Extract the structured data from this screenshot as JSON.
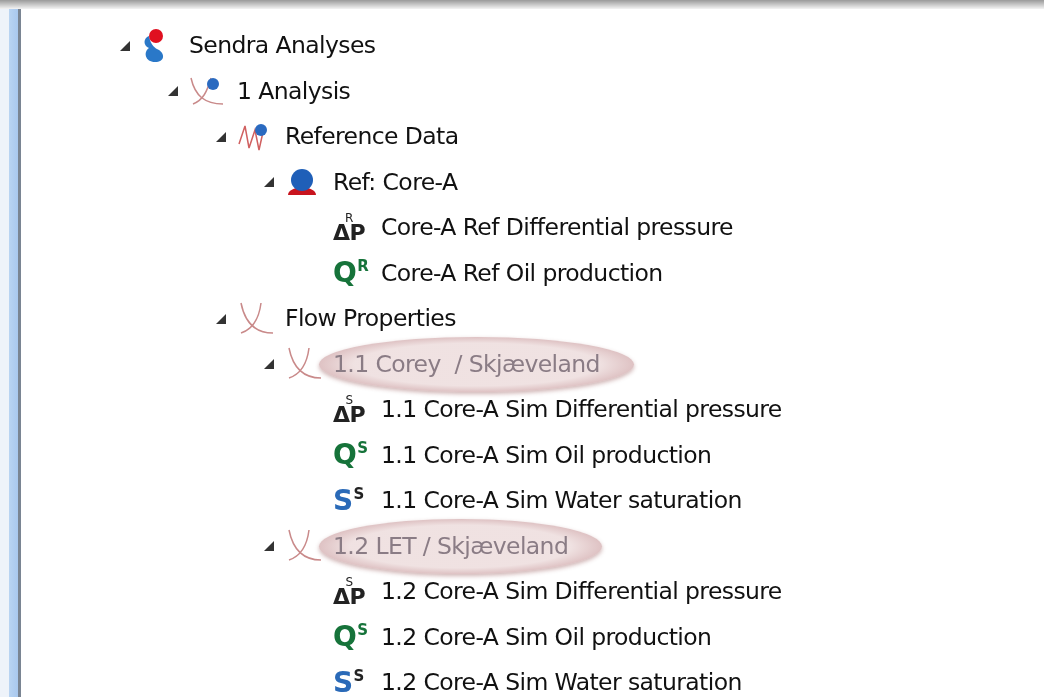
{
  "tree": [
    {
      "label": "Sendra Analyses",
      "kind": "dataset",
      "expanded": true,
      "highlighted": false,
      "children": [
        {
          "label": "1 Analysis",
          "kind": "analysis",
          "expanded": true,
          "highlighted": false,
          "children": [
            {
              "label": "Reference Data",
              "kind": "reference",
              "expanded": true,
              "highlighted": false,
              "children": [
                {
                  "label": "Ref: Core-A",
                  "kind": "core",
                  "expanded": true,
                  "highlighted": false,
                  "children": [
                    {
                      "label": "Core-A Ref Differential pressure",
                      "kind": "pressure",
                      "symbol": "ΔP",
                      "sup": "R",
                      "highlighted": false
                    },
                    {
                      "label": "Core-A Ref Oil production",
                      "kind": "production",
                      "symbol": "Q",
                      "sup": "R",
                      "highlighted": false
                    }
                  ]
                }
              ]
            },
            {
              "label": "Flow Properties",
              "kind": "flow",
              "expanded": true,
              "highlighted": false,
              "children": [
                {
                  "label": "1.1 Corey  / Skjæveland",
                  "kind": "flow",
                  "expanded": true,
                  "highlighted": true,
                  "children": [
                    {
                      "label": "1.1 Core-A Sim Differential pressure",
                      "kind": "pressure",
                      "symbol": "ΔP",
                      "sup": "S",
                      "highlighted": false
                    },
                    {
                      "label": "1.1 Core-A Sim Oil production",
                      "kind": "production",
                      "symbol": "Q",
                      "sup": "S",
                      "highlighted": false
                    },
                    {
                      "label": "1.1 Core-A Sim Water saturation",
                      "kind": "saturation",
                      "symbol": "S",
                      "sup": "S",
                      "highlighted": false
                    }
                  ]
                },
                {
                  "label": "1.2 LET / Skjæveland",
                  "kind": "flow",
                  "expanded": true,
                  "highlighted": true,
                  "children": [
                    {
                      "label": "1.2 Core-A Sim Differential pressure",
                      "kind": "pressure",
                      "symbol": "ΔP",
                      "sup": "S",
                      "highlighted": false
                    },
                    {
                      "label": "1.2 Core-A Sim Oil production",
                      "kind": "production",
                      "symbol": "Q",
                      "sup": "S",
                      "highlighted": false
                    },
                    {
                      "label": "1.2 Core-A Sim Water saturation",
                      "kind": "saturation",
                      "symbol": "S",
                      "sup": "S",
                      "highlighted": false
                    }
                  ]
                }
              ]
            }
          ]
        }
      ]
    }
  ]
}
